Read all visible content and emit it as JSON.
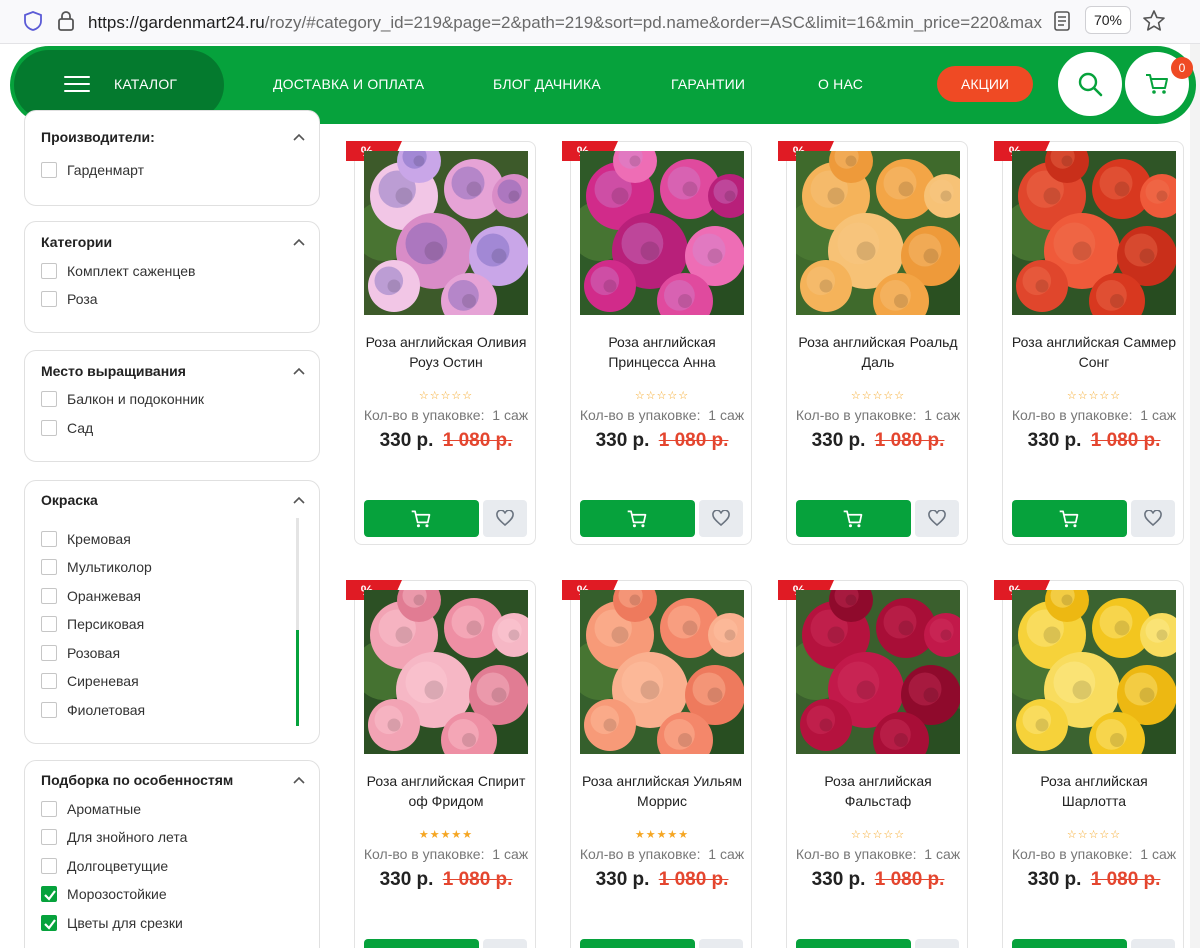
{
  "browser": {
    "url_host": "https://gardenmart24.ru",
    "url_rest": "/rozy/#category_id=219&page=2&path=219&sort=pd.name&order=ASC&limit=16&min_price=220&max",
    "zoom": "70%"
  },
  "header": {
    "catalog_label": "КАТАЛОГ",
    "nav": [
      "ДОСТАВКА И ОПЛАТА",
      "БЛОГ ДАЧНИКА",
      "ГАРАНТИИ",
      "О НАС"
    ],
    "promo_label": "АКЦИИ",
    "cart_count": "0"
  },
  "filters": [
    {
      "title": "Производители:",
      "options": [
        {
          "label": "Гарденмарт",
          "checked": false
        }
      ]
    },
    {
      "title": "Категории",
      "options": [
        {
          "label": "Комплект саженцев",
          "checked": false
        },
        {
          "label": "Роза",
          "checked": false
        }
      ]
    },
    {
      "title": "Место выращивания",
      "options": [
        {
          "label": "Балкон и подоконник",
          "checked": false
        },
        {
          "label": "Сад",
          "checked": false
        }
      ]
    },
    {
      "title": "Окраска",
      "options": [
        {
          "label": "Кремовая",
          "checked": false
        },
        {
          "label": "Мультиколор",
          "checked": false
        },
        {
          "label": "Оранжевая",
          "checked": false
        },
        {
          "label": "Персиковая",
          "checked": false
        },
        {
          "label": "Розовая",
          "checked": false
        },
        {
          "label": "Сиреневая",
          "checked": false
        },
        {
          "label": "Фиолетовая",
          "checked": false
        }
      ]
    },
    {
      "title": "Подборка по особенностям",
      "options": [
        {
          "label": "Ароматные",
          "checked": false
        },
        {
          "label": "Для знойного лета",
          "checked": false
        },
        {
          "label": "Долгоцветущие",
          "checked": false
        },
        {
          "label": "Морозостойкие",
          "checked": true
        },
        {
          "label": "Цветы для срезки",
          "checked": true
        }
      ]
    }
  ],
  "sale_badge": "%",
  "products": [
    {
      "name_line1": "Роза английская Оливия",
      "name_line2": "Роуз Остин",
      "rating": 0,
      "pack_label": "Кол-во в упаковке:",
      "pack_value": "1 саж",
      "price": "330 р.",
      "old_price": "1 080 р.",
      "photo": "lavender"
    },
    {
      "name_line1": "Роза английская",
      "name_line2": "Принцесса Анна",
      "rating": 0,
      "pack_label": "Кол-во в упаковке:",
      "pack_value": "1 саж",
      "price": "330 р.",
      "old_price": "1 080 р.",
      "photo": "magenta"
    },
    {
      "name_line1": "Роза английская Роальд",
      "name_line2": "Даль",
      "rating": 0,
      "pack_label": "Кол-во в упаковке:",
      "pack_value": "1 саж",
      "price": "330 р.",
      "old_price": "1 080 р.",
      "photo": "apricot"
    },
    {
      "name_line1": "Роза английская Саммер",
      "name_line2": "Сонг",
      "rating": 0,
      "pack_label": "Кол-во в упаковке:",
      "pack_value": "1 саж",
      "price": "330 р.",
      "old_price": "1 080 р.",
      "photo": "red-orange"
    },
    {
      "name_line1": "Роза английская Спирит",
      "name_line2": "оф Фридом",
      "rating": 5,
      "pack_label": "Кол-во в упаковке:",
      "pack_value": "1 саж",
      "price": "330 р.",
      "old_price": "1 080 р.",
      "photo": "pink"
    },
    {
      "name_line1": "Роза английская Уильям",
      "name_line2": "Моррис",
      "rating": 5,
      "pack_label": "Кол-во в упаковке:",
      "pack_value": "1 саж",
      "price": "330 р.",
      "old_price": "1 080 р.",
      "photo": "peach"
    },
    {
      "name_line1": "Роза английская",
      "name_line2": "Фальстаф",
      "rating": 0,
      "pack_label": "Кол-во в упаковке:",
      "pack_value": "1 саж",
      "price": "330 р.",
      "old_price": "1 080 р.",
      "photo": "crimson"
    },
    {
      "name_line1": "Роза английская",
      "name_line2": "Шарлотта",
      "rating": 0,
      "pack_label": "Кол-во в упаковке:",
      "pack_value": "1 саж",
      "price": "330 р.",
      "old_price": "1 080 р.",
      "photo": "yellow"
    }
  ],
  "colors": {
    "brand": "#06a23c",
    "brand_dark": "#047a2e",
    "accent": "#ef4a24",
    "sale": "#e01b24"
  }
}
